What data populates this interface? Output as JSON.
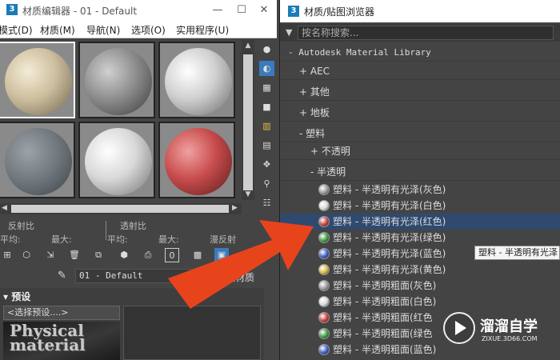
{
  "editor": {
    "title": "材质编辑器 - 01 - Default",
    "menu": [
      "模式(D)",
      "材质(M)",
      "导航(N)",
      "选项(O)",
      "实用程序(U)"
    ],
    "params": {
      "reflect_label": "反射比",
      "transmit_label": "透射比",
      "avg_left": "平均:",
      "max_left": "最大:",
      "avg_right": "平均:",
      "max_right": "最大:",
      "diffuse_label": "漫反射"
    },
    "material_name": "01 - Default",
    "material_type": "理材质",
    "presets": {
      "header": "预设",
      "select_value": "<选择预设....>",
      "thumbnail_text": "Physical material"
    },
    "toolbar_zero": "0"
  },
  "browser": {
    "title": "材质/贴图浏览器",
    "search_placeholder": "按名称搜索...",
    "library": "- Autodesk Material Library",
    "groups": [
      {
        "label": "+ AEC"
      },
      {
        "label": "+ 其他"
      },
      {
        "label": "+ 地板"
      },
      {
        "label": "- 塑料"
      }
    ],
    "subgroups": [
      {
        "label": "+ 不透明"
      },
      {
        "label": "- 半透明"
      }
    ],
    "items": [
      {
        "label": "塑料 - 半透明有光泽(灰色)",
        "color": "#9a9a9a"
      },
      {
        "label": "塑料 - 半透明有光泽(白色)",
        "color": "#d8d8d8"
      },
      {
        "label": "塑料 - 半透明有光泽(红色)",
        "color": "#c43c3c"
      },
      {
        "label": "塑料 - 半透明有光泽(绿色)",
        "color": "#3c9a3c"
      },
      {
        "label": "塑料 - 半透明有光泽(蓝色)",
        "color": "#3c5ac4"
      },
      {
        "label": "塑料 - 半透明有光泽(黄色)",
        "color": "#d4b83a"
      },
      {
        "label": "塑料 - 半透明粗面(灰色)",
        "color": "#9a9a9a"
      },
      {
        "label": "塑料 - 半透明粗面(白色)",
        "color": "#d8d8d8"
      },
      {
        "label": "塑料 - 半透明粗面(红色",
        "color": "#c43c3c"
      },
      {
        "label": "塑料 - 半透明粗面(绿色",
        "color": "#3c9a3c"
      },
      {
        "label": "塑料 - 半透明粗面(蓝色)",
        "color": "#3c5ac4"
      }
    ],
    "selected_index": 2,
    "tooltip": "塑料 - 半透明有光泽"
  },
  "watermark": {
    "text": "溜溜自学",
    "url": "ZIXUE.3D66.COM"
  },
  "colors": {
    "arrow": "#e8441c",
    "selection": "#2f4a6e"
  }
}
